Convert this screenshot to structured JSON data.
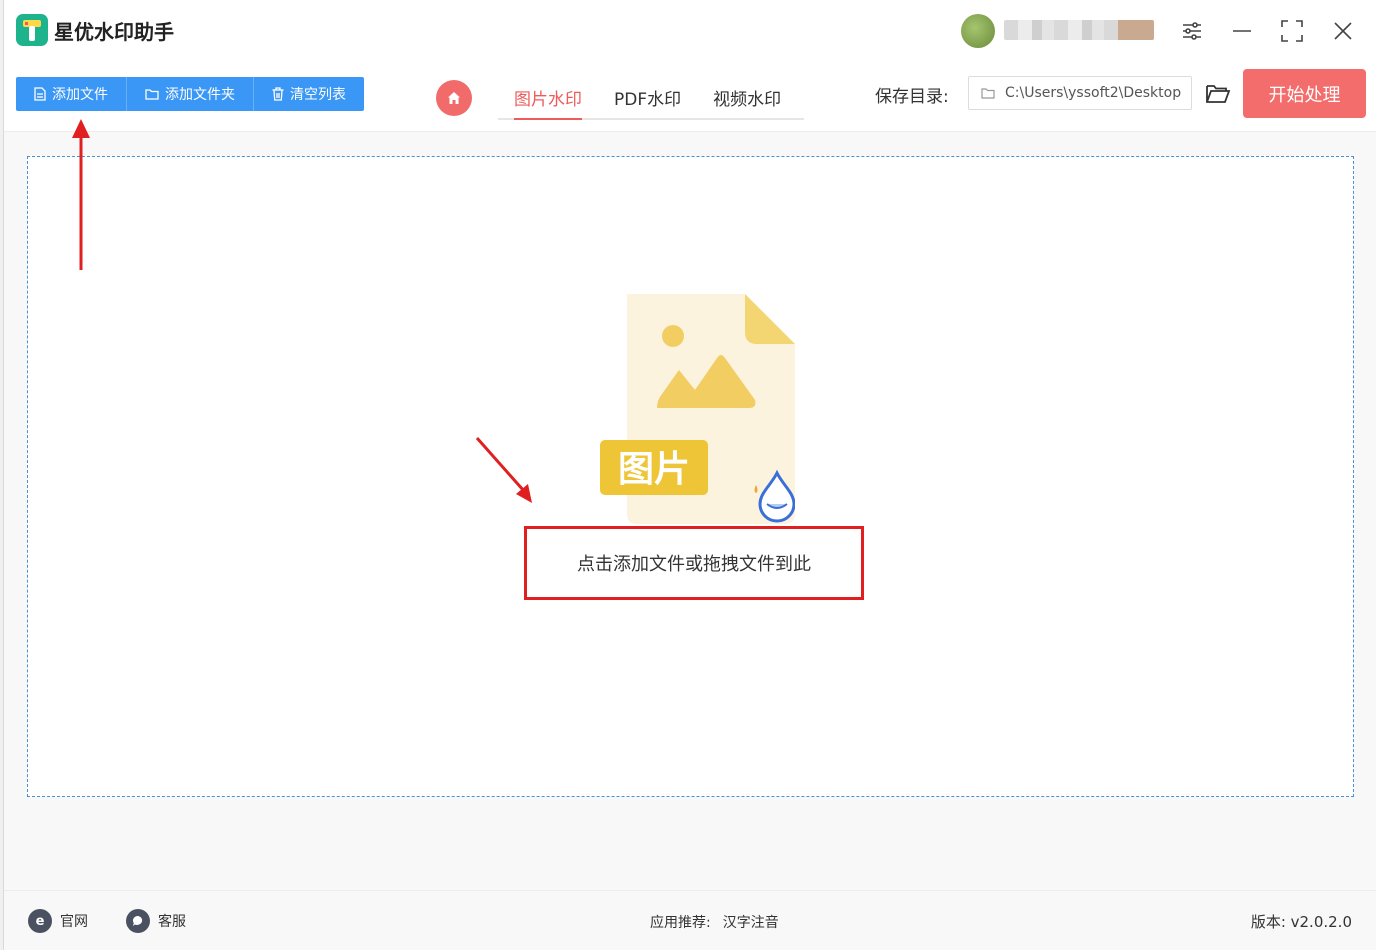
{
  "app": {
    "title": "星优水印助手"
  },
  "toolbar": {
    "add_file": "添加文件",
    "add_folder": "添加文件夹",
    "clear_list": "清空列表",
    "tabs": [
      {
        "label": "图片水印",
        "active": true
      },
      {
        "label": "PDF水印",
        "active": false
      },
      {
        "label": "视频水印",
        "active": false
      }
    ],
    "save_dir_label": "保存目录:",
    "save_dir_value": "C:\\Users\\yssoft2\\Desktop",
    "start_label": "开始处理"
  },
  "dropzone": {
    "badge_text": "图片",
    "hint": "点击添加文件或拖拽文件到此"
  },
  "footer": {
    "website": "官网",
    "support": "客服",
    "recommend_label": "应用推荐:",
    "recommend_app": "汉字注音",
    "version": "版本: v2.0.2.0"
  },
  "colors": {
    "primary_blue": "#3a97f5",
    "accent_red": "#f46d6d",
    "tab_active": "#ef5b5b",
    "annotation_red": "#e02020"
  },
  "icons": [
    "file-icon",
    "folder-icon",
    "trash-icon",
    "home-icon",
    "settings-icon",
    "minimize-icon",
    "maximize-icon",
    "close-icon",
    "open-folder-icon",
    "ie-icon",
    "chat-icon"
  ]
}
